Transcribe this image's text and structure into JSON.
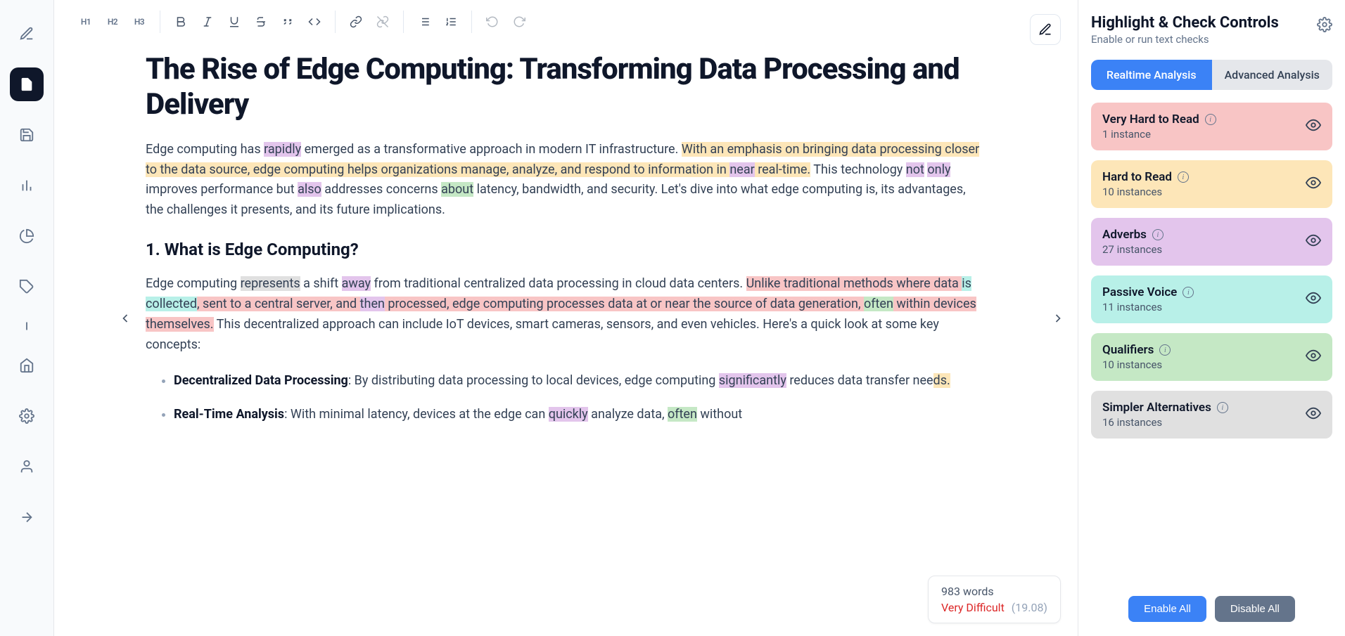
{
  "sidebar": {
    "items": [
      "edit",
      "document",
      "save",
      "bar-chart",
      "pie-chart",
      "tag",
      "line",
      "home",
      "settings",
      "user",
      "arrow-right"
    ]
  },
  "toolbar": {
    "h1": "H1",
    "h2": "H2",
    "h3": "H3"
  },
  "document": {
    "title": "The Rise of Edge Computing: Transforming Data Processing and Delivery",
    "p1_a": "Edge computing has ",
    "p1_rapidly": "rapidly",
    "p1_b": " emerged as a transformative approach in modern IT infrastructure. ",
    "p1_hard1a": "With an emphasis on bringing data processing closer to the data source, edge computing helps organizations manage, analyze, and respond to information in ",
    "p1_near": "near",
    "p1_hard1b": " real-time.",
    "p1_c": " This technology ",
    "p1_not": "not",
    "p1_d": " ",
    "p1_only": "only",
    "p1_e": " improves performance but ",
    "p1_also": "also",
    "p1_f": " addresses concerns ",
    "p1_about": "about",
    "p1_g": " latency, bandwidth, and security. Let's dive into what edge computing is, its advantages, the challenges it presents, and its future implications.",
    "h2_1": "1. What is Edge Computing?",
    "p2_a": "Edge computing ",
    "p2_represents": "represents",
    "p2_b": " a shift ",
    "p2_away": "away",
    "p2_c": " from traditional centralized data processing in cloud data centers. ",
    "p2_vh_a": "Unlike traditional methods where data ",
    "p2_collected": "is collected",
    "p2_vh_b": ", sent to a central server, and ",
    "p2_then": "then",
    "p2_vh_c": " processed, edge computing processes data at or near the source of data generation, ",
    "p2_often": "often",
    "p2_vh_d": " within devices themselves.",
    "p2_d": " This decentralized approach can include IoT devices, smart cameras, sensors, and even vehicles. Here's a quick look at some key concepts:",
    "li1_bold": "Decentralized Data Processing",
    "li1_a": ": By distributing data processing to local devices, edge computing ",
    "li1_sig": "significantly",
    "li1_b": " reduces data transfer nee",
    "li1_ds": "ds.",
    "li2_bold": "Real-Time Analysis",
    "li2_a": ": With minimal latency, devices at the edge can ",
    "li2_quickly": "quickly",
    "li2_b": " analyze data, ",
    "li2_often": "often",
    "li2_c": " without"
  },
  "stats": {
    "words": "983 words",
    "difficulty": "Very Difficult",
    "score": "(19.08)"
  },
  "panel": {
    "title": "Highlight & Check Controls",
    "subtitle": "Enable or run text checks",
    "tab_realtime": "Realtime Analysis",
    "tab_advanced": "Advanced Analysis",
    "checks": [
      {
        "title": "Very Hard to Read",
        "count": "1 instance"
      },
      {
        "title": "Hard to Read",
        "count": "10 instances"
      },
      {
        "title": "Adverbs",
        "count": "27 instances"
      },
      {
        "title": "Passive Voice",
        "count": "11 instances"
      },
      {
        "title": "Qualifiers",
        "count": "10 instances"
      },
      {
        "title": "Simpler Alternatives",
        "count": "16 instances"
      }
    ],
    "enable_all": "Enable All",
    "disable_all": "Disable All"
  }
}
